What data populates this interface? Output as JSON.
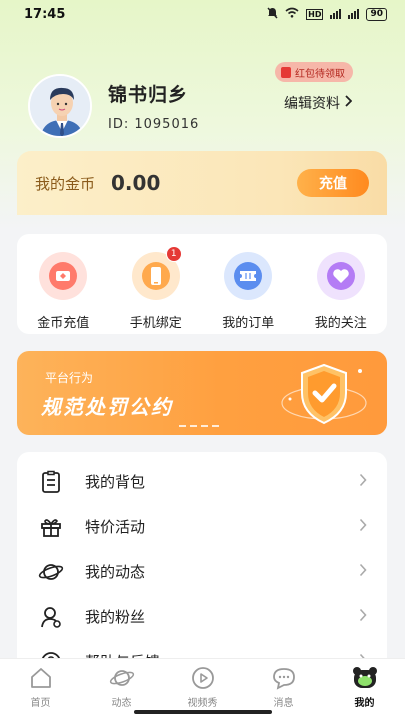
{
  "status_bar": {
    "time": "17:45",
    "battery": "90"
  },
  "profile": {
    "nickname": "锦书归乡",
    "uid": "ID: 1095016",
    "edit_label": "编辑资料",
    "redpacket_tip": "红包待领取"
  },
  "coins": {
    "label": "我的金币",
    "value": "0.00",
    "recharge_label": "充值"
  },
  "shortcuts": [
    {
      "label": "金币充值",
      "color": "#ff7a6b"
    },
    {
      "label": "手机绑定",
      "color": "#ffa94d",
      "badge": "1"
    },
    {
      "label": "我的订单",
      "color": "#5b8def"
    },
    {
      "label": "我的关注",
      "color": "#b47cf5"
    }
  ],
  "banner": {
    "subtitle": "平台行为",
    "title": "规范处罚公约"
  },
  "menu": [
    {
      "label": "我的背包",
      "icon": "clipboard-icon"
    },
    {
      "label": "特价活动",
      "icon": "gift-icon"
    },
    {
      "label": "我的动态",
      "icon": "planet-icon"
    },
    {
      "label": "我的粉丝",
      "icon": "person-icon"
    },
    {
      "label": "帮助与反馈",
      "icon": "help-icon"
    }
  ],
  "tabs": [
    {
      "label": "首页",
      "icon": "home-icon"
    },
    {
      "label": "动态",
      "icon": "planet-icon"
    },
    {
      "label": "视频秀",
      "icon": "play-icon"
    },
    {
      "label": "消息",
      "icon": "chat-icon"
    },
    {
      "label": "我的",
      "icon": "bear-icon",
      "active": true
    }
  ]
}
